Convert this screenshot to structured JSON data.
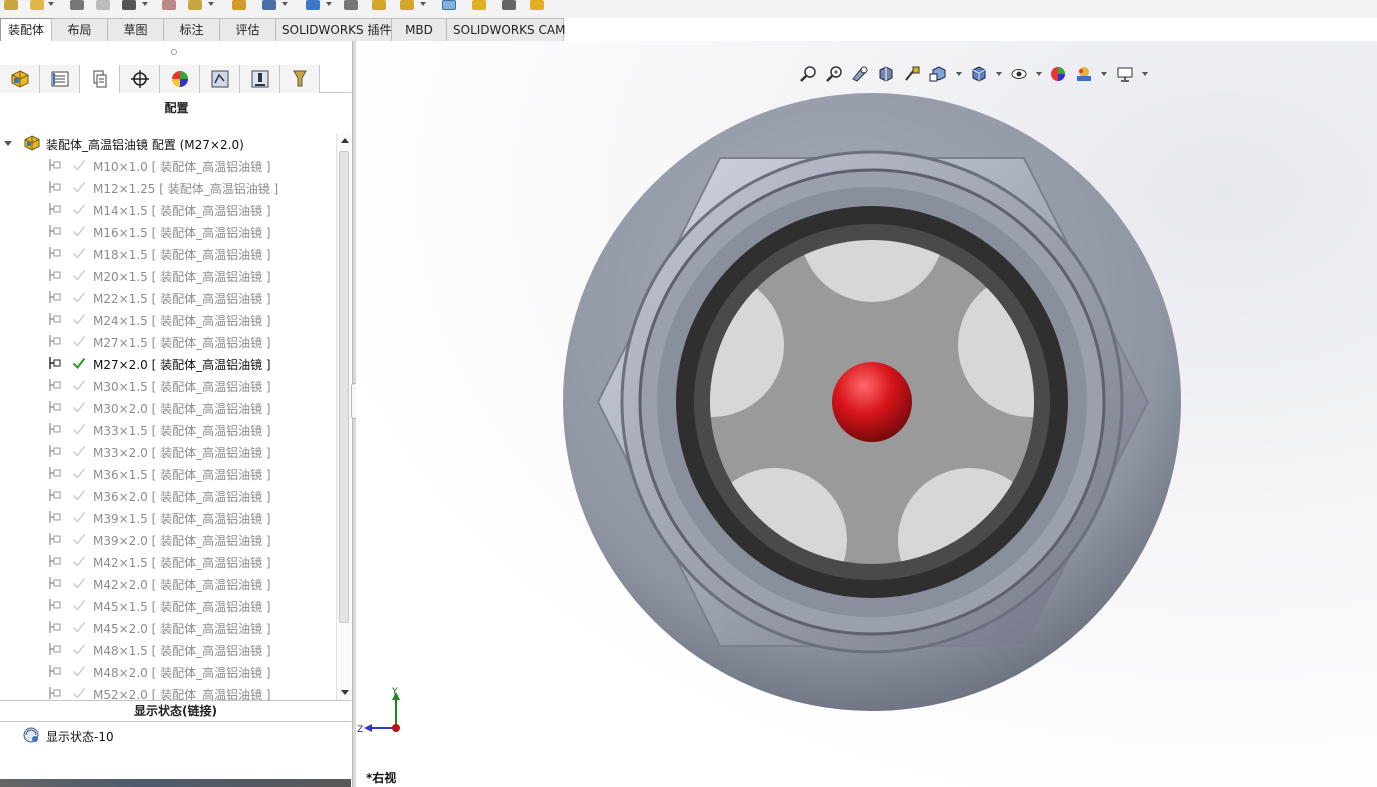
{
  "command_tabs": [
    {
      "label": "装配体",
      "active": true
    },
    {
      "label": "布局",
      "active": false
    },
    {
      "label": "草图",
      "active": false
    },
    {
      "label": "标注",
      "active": false
    },
    {
      "label": "评估",
      "active": false
    },
    {
      "label": "SOLIDWORKS 插件",
      "active": false
    },
    {
      "label": "MBD",
      "active": false
    },
    {
      "label": "SOLIDWORKS CAM",
      "active": false
    }
  ],
  "panel_tabs": [
    {
      "icon": "feature-manager-icon"
    },
    {
      "icon": "property-manager-icon"
    },
    {
      "icon": "configuration-manager-icon",
      "active": true
    },
    {
      "icon": "dimxpert-icon"
    },
    {
      "icon": "display-manager-icon"
    },
    {
      "icon": "cam-feature-tree-icon"
    },
    {
      "icon": "cam-operation-tree-icon"
    },
    {
      "icon": "cam-tool-tree-icon"
    }
  ],
  "config_panel": {
    "title": "配置",
    "root_label": "装配体_高温铝油镜 配置  (M27×2.0)",
    "items": [
      {
        "label": "M10×1.0 [ 装配体_高温铝油镜 ]",
        "active": false
      },
      {
        "label": "M12×1.25 [ 装配体_高温铝油镜 ]",
        "active": false
      },
      {
        "label": "M14×1.5 [ 装配体_高温铝油镜 ]",
        "active": false
      },
      {
        "label": "M16×1.5 [ 装配体_高温铝油镜 ]",
        "active": false
      },
      {
        "label": "M18×1.5 [ 装配体_高温铝油镜 ]",
        "active": false
      },
      {
        "label": "M20×1.5 [ 装配体_高温铝油镜 ]",
        "active": false
      },
      {
        "label": "M22×1.5 [ 装配体_高温铝油镜 ]",
        "active": false
      },
      {
        "label": "M24×1.5 [ 装配体_高温铝油镜 ]",
        "active": false
      },
      {
        "label": "M27×1.5 [ 装配体_高温铝油镜 ]",
        "active": false
      },
      {
        "label": "M27×2.0 [ 装配体_高温铝油镜 ]",
        "active": true
      },
      {
        "label": "M30×1.5 [ 装配体_高温铝油镜 ]",
        "active": false
      },
      {
        "label": "M30×2.0 [ 装配体_高温铝油镜 ]",
        "active": false
      },
      {
        "label": "M33×1.5 [ 装配体_高温铝油镜 ]",
        "active": false
      },
      {
        "label": "M33×2.0 [ 装配体_高温铝油镜 ]",
        "active": false
      },
      {
        "label": "M36×1.5 [ 装配体_高温铝油镜 ]",
        "active": false
      },
      {
        "label": "M36×2.0 [ 装配体_高温铝油镜 ]",
        "active": false
      },
      {
        "label": "M39×1.5 [ 装配体_高温铝油镜 ]",
        "active": false
      },
      {
        "label": "M39×2.0 [ 装配体_高温铝油镜 ]",
        "active": false
      },
      {
        "label": "M42×1.5 [ 装配体_高温铝油镜 ]",
        "active": false
      },
      {
        "label": "M42×2.0 [ 装配体_高温铝油镜 ]",
        "active": false
      },
      {
        "label": "M45×1.5 [ 装配体_高温铝油镜 ]",
        "active": false
      },
      {
        "label": "M45×2.0 [ 装配体_高温铝油镜 ]",
        "active": false
      },
      {
        "label": "M48×1.5 [ 装配体_高温铝油镜 ]",
        "active": false
      },
      {
        "label": "M48×2.0 [ 装配体_高温铝油镜 ]",
        "active": false
      },
      {
        "label": "M52×2.0 [ 装配体_高温铝油镜 ]",
        "active": false
      }
    ]
  },
  "display_state": {
    "section_title": "显示状态(链接)",
    "item_label": "显示状态-10"
  },
  "viewport": {
    "view_name": "*右视",
    "triad_y": "Y",
    "triad_z": "Z",
    "heads_up_icons": [
      "zoom-to-fit-icon",
      "zoom-to-area-icon",
      "previous-view-icon",
      "section-view-icon",
      "dynamic-annotation-icon",
      "view-orientation-icon",
      "display-style-icon",
      "hide-show-items-icon",
      "edit-appearance-icon",
      "apply-scene-icon",
      "view-settings-icon"
    ]
  },
  "colors": {
    "accent_check": "#2a9a2a",
    "ring_outer": "#8f95a3",
    "hex_nut": "#a2a8b6",
    "gasket": "#2f2f2f",
    "glass": "#d7d7d7",
    "spider": "#9a9a9a",
    "ball": "#d8141a"
  }
}
